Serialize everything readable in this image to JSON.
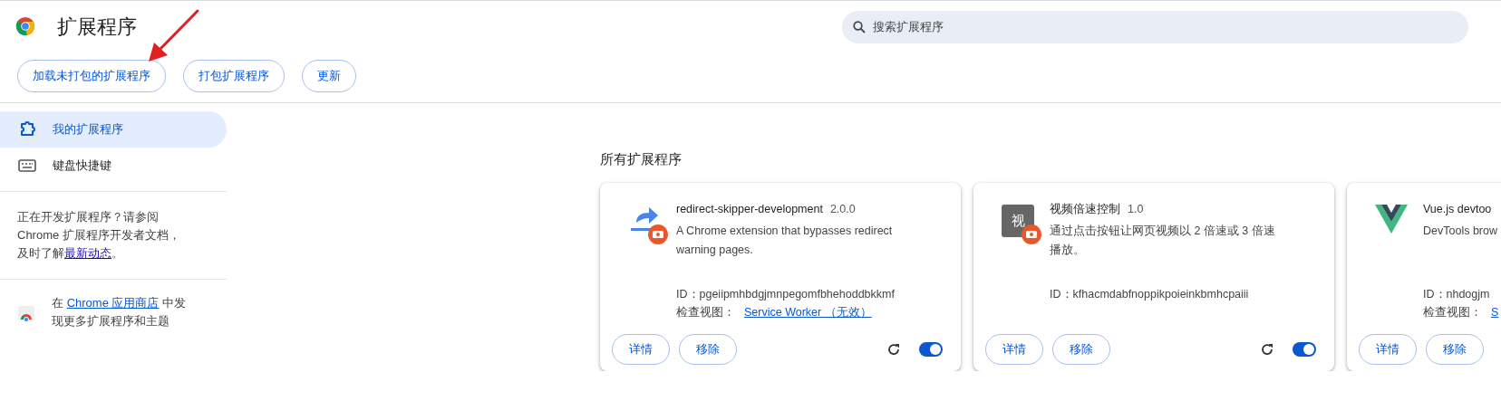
{
  "header": {
    "title": "扩展程序",
    "search": {
      "placeholder": "搜索扩展程序"
    },
    "buttons": [
      "加载未打包的扩展程序",
      "打包扩展程序",
      "更新"
    ]
  },
  "sidebar": {
    "items": [
      {
        "label": "我的扩展程序",
        "kind": "puzzle",
        "selected": true
      },
      {
        "label": "键盘快捷键",
        "kind": "keyboard",
        "selected": false
      }
    ],
    "dev_note": {
      "before": "正在开发扩展程序？请参阅 Chrome 扩展程序开发者文档，及时了解",
      "link": "最新动态",
      "after": "。"
    },
    "store_note": {
      "before": "在 ",
      "link": "Chrome 应用商店",
      "after": " 中发现更多扩展程序和主题"
    }
  },
  "section_title": "所有扩展程序",
  "extensions": [
    {
      "kind": "redirect",
      "badge": true,
      "name": "redirect-skipper-development",
      "version": "2.0.0",
      "description": "A Chrome extension that bypasses redirect warning pages.",
      "id": "ID：pgeiipmhbdgjmnpegomfbhehoddbkkmf",
      "inspect_label": "检查视图：",
      "inspect_link": "Service Worker （无效）",
      "buttons": [
        "详情",
        "移除"
      ],
      "reload": true,
      "enabled": true
    },
    {
      "kind": "letter",
      "icon_text": "视",
      "badge": true,
      "name": "视频倍速控制",
      "version": "1.0",
      "description": "通过点击按钮让网页视频以 2 倍速或 3 倍速播放。",
      "id": "ID：kfhacmdabfnoppikpoieinkbmhcpaiii",
      "buttons": [
        "详情",
        "移除"
      ],
      "reload": true,
      "enabled": true
    },
    {
      "kind": "vue",
      "badge": false,
      "name": "Vue.js devtoo",
      "description": "DevTools brow",
      "id": "ID：nhdogjm",
      "inspect_label": "检查视图：",
      "inspect_link": "S",
      "buttons": [
        "详情",
        "移除"
      ]
    }
  ]
}
